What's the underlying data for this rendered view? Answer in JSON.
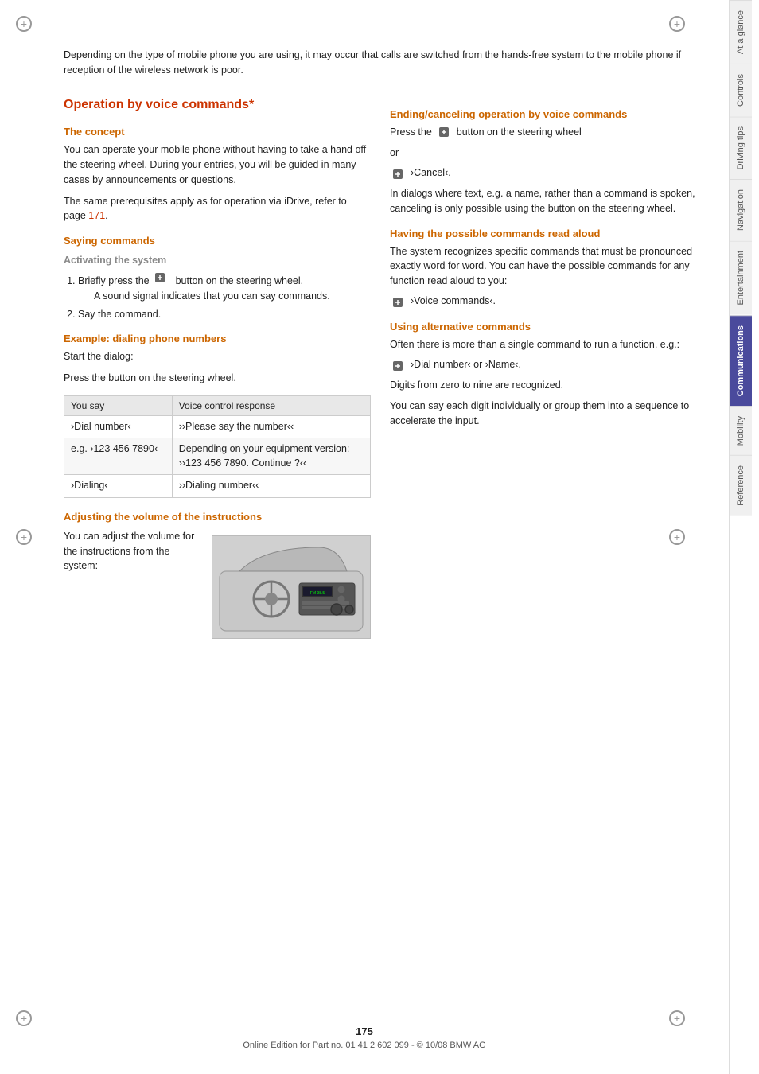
{
  "page": {
    "number": "175",
    "footer_text": "Online Edition for Part no. 01 41 2 602 099 - © 10/08 BMW AG"
  },
  "intro": {
    "text": "Depending on the type of mobile phone you are using, it may occur that calls are switched from the hands-free system to the mobile phone if reception of the wireless network is poor."
  },
  "section": {
    "title": "Operation by voice commands*",
    "concept": {
      "heading": "The concept",
      "para1": "You can operate your mobile phone without having to take a hand off the steering wheel. During your entries, you will be guided in many cases by announcements or questions.",
      "para2": "The same prerequisites apply as for operation via iDrive, refer to page",
      "page_link": "171",
      "para2_end": "."
    },
    "saying_commands": {
      "heading": "Saying commands",
      "activating": {
        "heading": "Activating the system",
        "step1": "Briefly press the",
        "step1_cont": "button on the steering wheel.",
        "step1_sub": "A sound signal indicates that you can say commands.",
        "step2": "Say the command."
      },
      "example": {
        "heading": "Example: dialing phone numbers",
        "start": "Start the dialog:",
        "press": "Press the button on the steering wheel.",
        "table": {
          "col1_header": "You say",
          "col2_header": "Voice control response",
          "rows": [
            {
              "you_say": "›Dial number‹",
              "response": "››Please say the number‹‹"
            },
            {
              "you_say": "e.g. ›123 456 7890‹",
              "response": "Depending on your equipment version:\n››123 456 7890. Continue ?‹‹"
            },
            {
              "you_say": "›Dialing‹",
              "response": "››Dialing number‹‹"
            }
          ]
        }
      },
      "adjusting": {
        "heading": "Adjusting the volume of the instructions",
        "text": "You can adjust the volume for the instructions from the system:"
      }
    },
    "ending": {
      "heading": "Ending/canceling operation by voice commands",
      "para1": "Press the",
      "para1_cont": "button on the steering wheel",
      "or": "or",
      "cmd": "›Cancel‹.",
      "para2": "In dialogs where text, e.g. a name, rather than a command is spoken, canceling is only possible using the button on the steering wheel."
    },
    "possible_commands": {
      "heading": "Having the possible commands read aloud",
      "para1": "The system recognizes specific commands that must be pronounced exactly word for word. You can have the possible commands for any function read aloud to you:",
      "cmd": "›Voice commands‹."
    },
    "alternative": {
      "heading": "Using alternative commands",
      "para1": "Often there is more than a single command to run a function, e.g.:",
      "cmd": "›Dial number‹ or ›Name‹.",
      "para2": "Digits from zero to nine are recognized.",
      "para3": "You can say each digit individually or group them into a sequence to accelerate the input."
    }
  },
  "sidebar": {
    "tabs": [
      {
        "label": "At a glance",
        "active": false
      },
      {
        "label": "Controls",
        "active": false
      },
      {
        "label": "Driving tips",
        "active": false
      },
      {
        "label": "Navigation",
        "active": false
      },
      {
        "label": "Entertainment",
        "active": false
      },
      {
        "label": "Communications",
        "active": true
      },
      {
        "label": "Mobility",
        "active": false
      },
      {
        "label": "Reference",
        "active": false
      }
    ]
  }
}
